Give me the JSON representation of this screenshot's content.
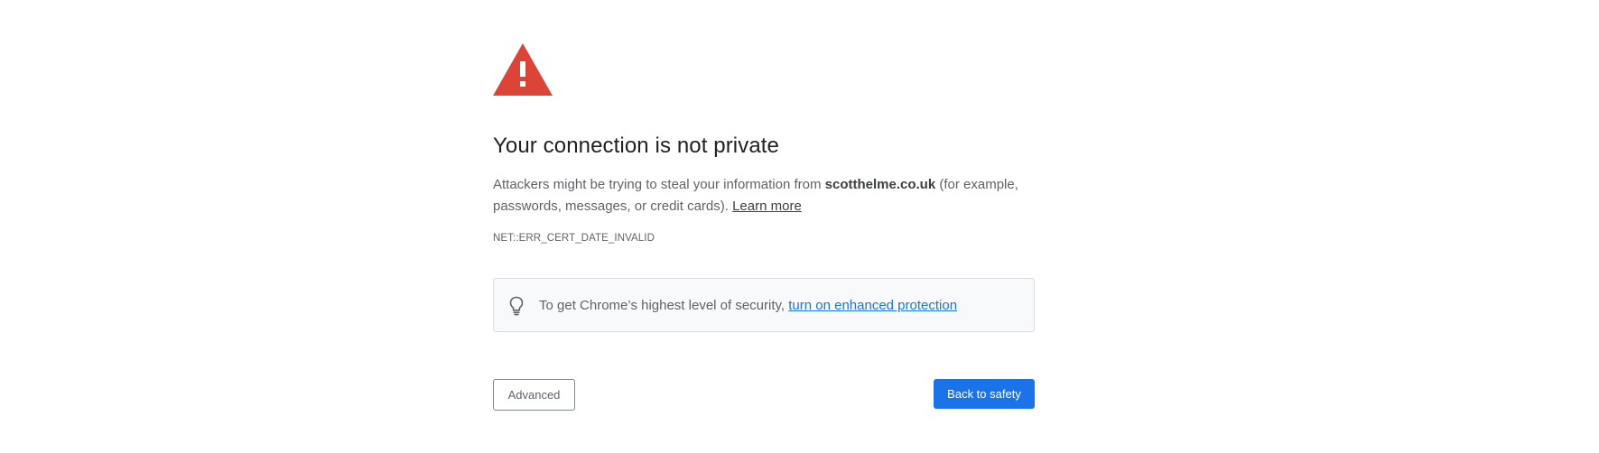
{
  "interstitial": {
    "icon": "warning-triangle-icon",
    "heading": "Your connection is not private",
    "message_before": "Attackers might be trying to steal your information from ",
    "domain": "scotthelme.co.uk",
    "message_after": " (for example, passwords, messages, or credit cards). ",
    "learn_more": "Learn more",
    "error_code": "NET::ERR_CERT_DATE_INVALID"
  },
  "enhanced_protection": {
    "icon": "lightbulb-icon",
    "text": "To get Chrome’s highest level of security, ",
    "link": "turn on enhanced protection"
  },
  "buttons": {
    "advanced": "Advanced",
    "back": "Back to safety"
  },
  "colors": {
    "warning_red": "#db4437",
    "primary_blue": "#1a73e8",
    "body_text": "#5f6368",
    "heading_text": "#202124"
  }
}
